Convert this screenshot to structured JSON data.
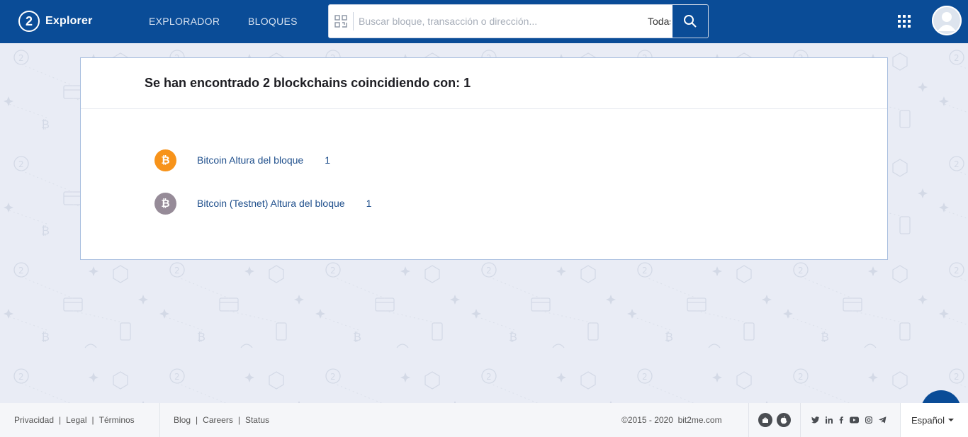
{
  "header": {
    "logo_mark": "2",
    "logo_text": "Explorer",
    "nav": [
      {
        "label": "EXPLORADOR"
      },
      {
        "label": "BLOQUES"
      }
    ],
    "search": {
      "placeholder": "Buscar bloque, transacción o dirección...",
      "network_value": "Todas"
    },
    "icons": {
      "qr": "qr-code-icon",
      "network": "network-icon",
      "search": "search-icon",
      "apps": "apps-grid-icon",
      "avatar": "user-avatar"
    }
  },
  "results": {
    "title": "Se han encontrado 2 blockchains coincidiendo con: 1",
    "items": [
      {
        "label": "Bitcoin Altura del bloque",
        "value": "1",
        "coin_symbol": "₿",
        "color": "#f7931a"
      },
      {
        "label": "Bitcoin (Testnet) Altura del bloque",
        "value": "1",
        "coin_symbol": "₿",
        "color": "#968b98"
      }
    ]
  },
  "footer": {
    "legal_links": [
      "Privacidad",
      "Legal",
      "Términos"
    ],
    "company_links": [
      "Blog",
      "Careers",
      "Status"
    ],
    "separator": "|",
    "copyright": "©2015 - 2020  bit2me.com",
    "language": "Español",
    "social_icons": [
      "twitter-icon",
      "linkedin-icon",
      "facebook-icon",
      "youtube-icon",
      "instagram-icon",
      "telegram-icon"
    ],
    "store_icons": [
      "android-icon",
      "apple-icon"
    ]
  },
  "colors": {
    "primary": "#0a4c97",
    "background": "#e9ecf5",
    "link": "#1f4f8c"
  }
}
